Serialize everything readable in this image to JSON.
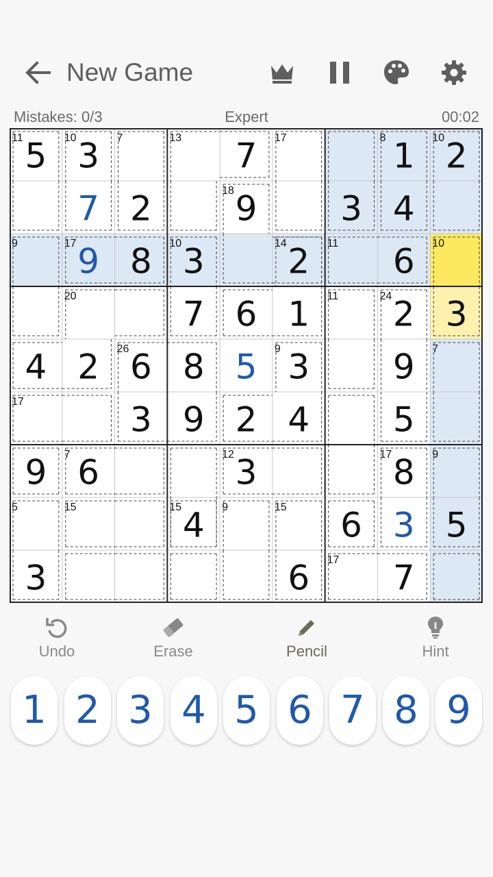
{
  "header": {
    "title": "New Game"
  },
  "status": {
    "mistakes": "Mistakes: 0/3",
    "difficulty": "Expert",
    "timer": "00:02"
  },
  "icons": {
    "back": "arrow-left-icon",
    "crown": "crown-icon",
    "pause": "pause-icon",
    "palette": "palette-icon",
    "settings": "gear-icon"
  },
  "colors": {
    "given_digit": "#111111",
    "user_digit": "#1f59ad",
    "highlight_row_col": "#dde8f5",
    "selected_cell": "#fde95f",
    "same_cage_cell": "#fdf2ad",
    "cell_line": "#c8c8c8",
    "box_line": "#222222"
  },
  "board": {
    "selected": [
      2,
      8
    ],
    "grid": [
      [
        5,
        3,
        0,
        0,
        7,
        0,
        0,
        1,
        2
      ],
      [
        0,
        7,
        2,
        0,
        9,
        0,
        3,
        4,
        0
      ],
      [
        0,
        9,
        8,
        3,
        0,
        2,
        0,
        6,
        0
      ],
      [
        0,
        0,
        0,
        7,
        6,
        1,
        0,
        2,
        3
      ],
      [
        4,
        2,
        6,
        8,
        5,
        3,
        0,
        9,
        0
      ],
      [
        0,
        0,
        3,
        9,
        2,
        4,
        0,
        5,
        0
      ],
      [
        9,
        6,
        0,
        0,
        3,
        0,
        0,
        8,
        0
      ],
      [
        0,
        0,
        0,
        4,
        0,
        0,
        6,
        3,
        5
      ],
      [
        3,
        0,
        0,
        0,
        0,
        6,
        0,
        7,
        0
      ]
    ],
    "user_entered": [
      [
        1,
        1
      ],
      [
        2,
        1
      ],
      [
        4,
        4
      ],
      [
        7,
        7
      ]
    ],
    "cages": [
      {
        "sum": "11",
        "cells": [
          [
            0,
            0
          ],
          [
            1,
            0
          ]
        ]
      },
      {
        "sum": "10",
        "cells": [
          [
            0,
            1
          ],
          [
            1,
            1
          ]
        ]
      },
      {
        "sum": "7",
        "cells": [
          [
            0,
            2
          ],
          [
            1,
            2
          ]
        ]
      },
      {
        "sum": "13",
        "cells": [
          [
            0,
            3
          ],
          [
            0,
            4
          ],
          [
            1,
            3
          ]
        ]
      },
      {
        "sum": "17",
        "cells": [
          [
            0,
            5
          ],
          [
            1,
            5
          ]
        ]
      },
      {
        "sum": "",
        "cells": [
          [
            0,
            6
          ],
          [
            1,
            6
          ]
        ]
      },
      {
        "sum": "8",
        "cells": [
          [
            0,
            7
          ],
          [
            1,
            7
          ]
        ]
      },
      {
        "sum": "10",
        "cells": [
          [
            0,
            8
          ],
          [
            1,
            8
          ]
        ]
      },
      {
        "sum": "18",
        "cells": [
          [
            1,
            4
          ],
          [
            2,
            4
          ],
          [
            2,
            5
          ]
        ]
      },
      {
        "sum": "9",
        "cells": [
          [
            2,
            0
          ],
          [
            3,
            0
          ]
        ]
      },
      {
        "sum": "17",
        "cells": [
          [
            2,
            1
          ],
          [
            2,
            2
          ]
        ]
      },
      {
        "sum": "10",
        "cells": [
          [
            2,
            3
          ],
          [
            3,
            3
          ]
        ]
      },
      {
        "sum": "14",
        "cells": [
          [
            2,
            5
          ],
          [
            3,
            4
          ],
          [
            3,
            5
          ]
        ]
      },
      {
        "sum": "11",
        "cells": [
          [
            2,
            6
          ],
          [
            2,
            7
          ]
        ]
      },
      {
        "sum": "10",
        "cells": [
          [
            2,
            8
          ],
          [
            3,
            8
          ]
        ]
      },
      {
        "sum": "20",
        "cells": [
          [
            3,
            1
          ],
          [
            3,
            2
          ],
          [
            4,
            0
          ],
          [
            4,
            1
          ]
        ]
      },
      {
        "sum": "11",
        "cells": [
          [
            3,
            6
          ],
          [
            4,
            6
          ]
        ]
      },
      {
        "sum": "24",
        "cells": [
          [
            3,
            7
          ],
          [
            4,
            7
          ],
          [
            5,
            7
          ]
        ]
      },
      {
        "sum": "26",
        "cells": [
          [
            4,
            2
          ],
          [
            5,
            2
          ],
          [
            4,
            3
          ],
          [
            5,
            3
          ]
        ]
      },
      {
        "sum": "9",
        "cells": [
          [
            4,
            5
          ],
          [
            5,
            4
          ],
          [
            5,
            5
          ]
        ]
      },
      {
        "sum": "7",
        "cells": [
          [
            4,
            8
          ],
          [
            5,
            8
          ]
        ]
      },
      {
        "sum": "17",
        "cells": [
          [
            5,
            0
          ],
          [
            5,
            1
          ]
        ]
      },
      {
        "sum": "",
        "cells": [
          [
            5,
            6
          ],
          [
            6,
            6
          ]
        ]
      },
      {
        "sum": "",
        "cells": [
          [
            6,
            0
          ]
        ]
      },
      {
        "sum": "7",
        "cells": [
          [
            6,
            1
          ],
          [
            6,
            2
          ]
        ]
      },
      {
        "sum": "",
        "cells": [
          [
            6,
            3
          ],
          [
            7,
            3
          ]
        ]
      },
      {
        "sum": "12",
        "cells": [
          [
            6,
            4
          ],
          [
            6,
            5
          ]
        ]
      },
      {
        "sum": "17",
        "cells": [
          [
            6,
            7
          ],
          [
            7,
            7
          ]
        ]
      },
      {
        "sum": "9",
        "cells": [
          [
            6,
            8
          ],
          [
            7,
            8
          ]
        ]
      },
      {
        "sum": "5",
        "cells": [
          [
            7,
            0
          ],
          [
            8,
            0
          ]
        ]
      },
      {
        "sum": "15",
        "cells": [
          [
            7,
            1
          ],
          [
            7,
            2
          ]
        ]
      },
      {
        "sum": "15",
        "cells": [
          [
            7,
            3
          ]
        ]
      },
      {
        "sum": "9",
        "cells": [
          [
            7,
            4
          ],
          [
            8,
            4
          ]
        ]
      },
      {
        "sum": "15",
        "cells": [
          [
            7,
            5
          ],
          [
            8,
            5
          ]
        ]
      },
      {
        "sum": "",
        "cells": [
          [
            7,
            6
          ]
        ]
      },
      {
        "sum": "",
        "cells": [
          [
            8,
            1
          ],
          [
            8,
            2
          ]
        ]
      },
      {
        "sum": "",
        "cells": [
          [
            8,
            3
          ]
        ]
      },
      {
        "sum": "17",
        "cells": [
          [
            8,
            6
          ],
          [
            8,
            7
          ]
        ]
      },
      {
        "sum": "",
        "cells": [
          [
            8,
            8
          ]
        ]
      }
    ]
  },
  "tools": [
    {
      "label": "Undo",
      "icon": "undo-icon"
    },
    {
      "label": "Erase",
      "icon": "eraser-icon"
    },
    {
      "label": "Pencil",
      "icon": "pencil-icon"
    },
    {
      "label": "Hint",
      "icon": "lightbulb-icon"
    }
  ],
  "numpad": [
    "1",
    "2",
    "3",
    "4",
    "5",
    "6",
    "7",
    "8",
    "9"
  ]
}
